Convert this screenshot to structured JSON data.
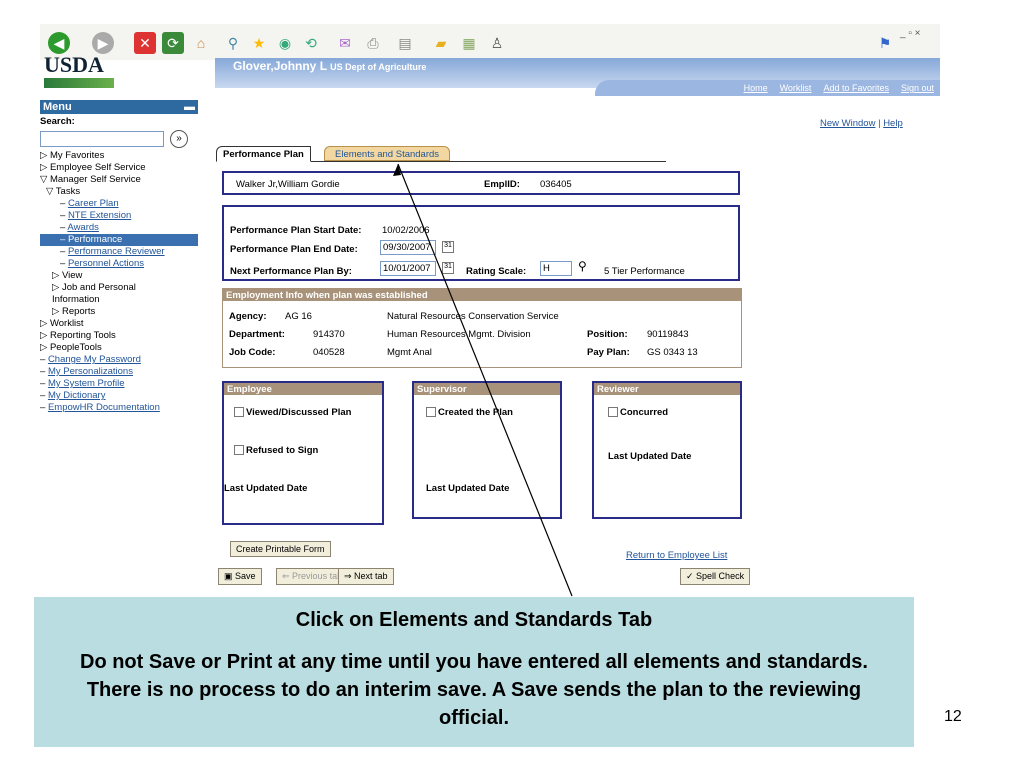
{
  "org": {
    "logo": "USDA"
  },
  "user": {
    "name": "Glover,Johnny L",
    "dept": "US Dept of Agriculture"
  },
  "nav": {
    "home": "Home",
    "worklist": "Worklist",
    "favorites": "Add to Favorites",
    "signout": "Sign out",
    "newwindow": "New Window",
    "help": "Help"
  },
  "menu": {
    "title": "Menu",
    "search": "Search:",
    "go": "»",
    "items": [
      "My Favorites",
      "Employee Self Service",
      "Manager Self Service",
      "Tasks",
      "Career Plan",
      "NTE Extension",
      "Awards",
      "Performance",
      "Performance Reviewer",
      "Personnel Actions",
      "View",
      "Job and Personal Information",
      "Reports",
      "Worklist",
      "Reporting Tools",
      "PeopleTools",
      "Change My Password",
      "My Personalizations",
      "My System Profile",
      "My Dictionary",
      "EmpowHR Documentation"
    ]
  },
  "tabs": {
    "active": "Performance Plan",
    "other": "Elements and Standards"
  },
  "employee": {
    "name": "Walker Jr,William Gordie",
    "emplid_label": "EmplID:",
    "emplid": "036405"
  },
  "plan": {
    "start_label": "Performance Plan Start Date:",
    "start": "10/02/2006",
    "end_label": "Performance Plan End Date:",
    "end": "09/30/2007",
    "next_label": "Next Performance Plan By:",
    "next": "10/01/2007",
    "rating_label": "Rating Scale:",
    "rating": "H",
    "rating_desc": "5 Tier Performance"
  },
  "employment": {
    "header": "Employment Info when plan was established",
    "agency_label": "Agency:",
    "agency": "AG 16",
    "agency_name": "Natural Resources Conservation Service",
    "dept_label": "Department:",
    "dept": "914370",
    "dept_name": "Human Resources Mgmt. Division",
    "position_label": "Position:",
    "position": "90119843",
    "job_label": "Job Code:",
    "job": "040528",
    "job_name": "Mgmt Anal",
    "payplan_label": "Pay Plan:",
    "payplan": "GS  0343 13"
  },
  "panels": {
    "employee": "Employee",
    "viewed": "Viewed/Discussed Plan",
    "refused": "Refused to Sign",
    "emp_last": "Last Updated Date",
    "supervisor": "Supervisor",
    "created": "Created the Plan",
    "sup_last": "Last Updated Date",
    "reviewer": "Reviewer",
    "concurred": "Concurred",
    "rev_last": "Last Updated Date"
  },
  "actions": {
    "printable": "Create Printable Form",
    "return": "Return to Employee List",
    "save": "Save",
    "prev": "Previous tab",
    "next": "Next tab",
    "spell": "Spell Check"
  },
  "callout": {
    "title": "Click on Elements and Standards Tab",
    "body": "Do not Save or Print at any time until you have entered all elements and standards.   There is no process to do an interim save.  A Save sends the plan to the reviewing official."
  },
  "page_number": "12"
}
